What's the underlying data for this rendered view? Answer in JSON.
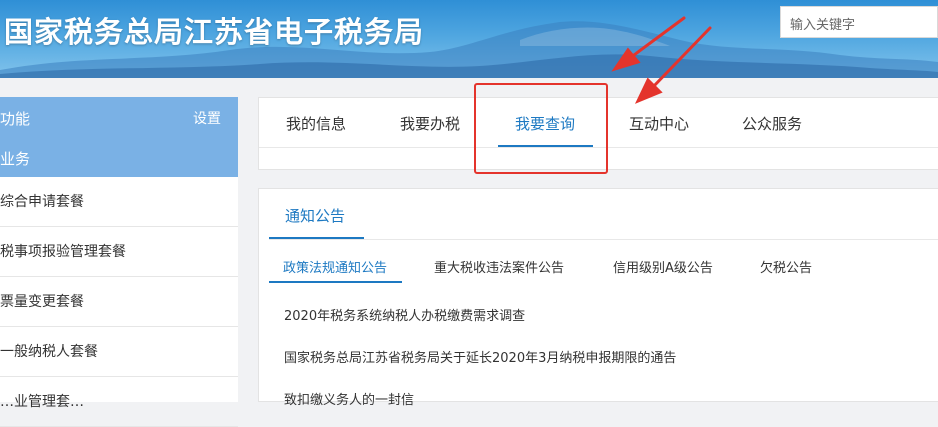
{
  "header": {
    "site_title": "国家税务总局江苏省电子税务局",
    "search_placeholder": "输入关键字"
  },
  "left_panel": {
    "title": "功能",
    "settings_label": "设置",
    "section_label": "业务",
    "items": [
      {
        "label": "综合申请套餐"
      },
      {
        "label": "税事项报验管理套餐"
      },
      {
        "label": "票量变更套餐"
      },
      {
        "label": "一般纳税人套餐"
      },
      {
        "label": "…业管理套…"
      }
    ]
  },
  "main_tabs": {
    "active": "我要查询",
    "items": [
      {
        "label": "我的信息"
      },
      {
        "label": "我要办税"
      },
      {
        "label": "我要查询"
      },
      {
        "label": "互动中心"
      },
      {
        "label": "公众服务"
      }
    ]
  },
  "notice": {
    "header": "通知公告",
    "subtabs": [
      {
        "label": "政策法规通知公告"
      },
      {
        "label": "重大税收违法案件公告"
      },
      {
        "label": "信用级别A级公告"
      },
      {
        "label": "欠税公告"
      }
    ],
    "active_subtab": "政策法规通知公告",
    "items": [
      {
        "title": "2020年税务系统纳税人办税缴费需求调查"
      },
      {
        "title": "国家税务总局江苏省税务局关于延长2020年3月纳税申报期限的通告"
      },
      {
        "title": "致扣缴义务人的一封信"
      }
    ]
  },
  "colors": {
    "accent": "#1d79c2",
    "highlight": "#e4342c",
    "left_head_bg": "#7ab1e5"
  }
}
